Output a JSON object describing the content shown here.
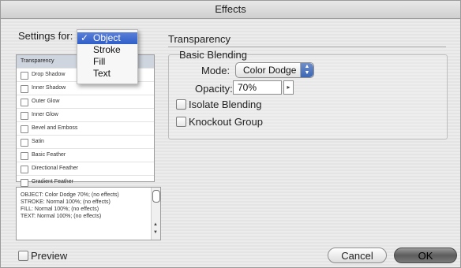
{
  "window": {
    "title": "Effects"
  },
  "settings": {
    "label": "Settings for:",
    "options": [
      {
        "label": "Object",
        "checked": true
      },
      {
        "label": "Stroke",
        "checked": false
      },
      {
        "label": "Fill",
        "checked": false
      },
      {
        "label": "Text",
        "checked": false
      }
    ],
    "selected": "Object",
    "check_glyph": "✓"
  },
  "effects_list": {
    "items": [
      {
        "label": "Transparency",
        "header": true
      },
      {
        "label": "Drop Shadow",
        "checked": false
      },
      {
        "label": "Inner Shadow",
        "checked": false
      },
      {
        "label": "Outer Glow",
        "checked": false
      },
      {
        "label": "Inner Glow",
        "checked": false
      },
      {
        "label": "Bevel and Emboss",
        "checked": false
      },
      {
        "label": "Satin",
        "checked": false
      },
      {
        "label": "Basic Feather",
        "checked": false
      },
      {
        "label": "Directional Feather",
        "checked": false
      },
      {
        "label": "Gradient Feather",
        "checked": false
      }
    ]
  },
  "summary": {
    "lines": [
      "OBJECT: Color Dodge 70%; (no effects)",
      "STROKE: Normal 100%; (no effects)",
      "FILL: Normal 100%; (no effects)",
      "TEXT: Normal 100%; (no effects)"
    ],
    "arrow_up": "▲",
    "arrow_down": "▼"
  },
  "panel": {
    "title": "Transparency",
    "group_title": "Basic Blending",
    "mode_label": "Mode:",
    "mode_value": "Color Dodge",
    "mode_stepper_up": "▲",
    "mode_stepper_down": "▼",
    "opacity_label": "Opacity:",
    "opacity_value": "70%",
    "opacity_stepper": "▸",
    "isolate_blending": {
      "label": "Isolate Blending",
      "checked": false
    },
    "knockout_group": {
      "label": "Knockout Group",
      "checked": false
    }
  },
  "footer": {
    "preview": {
      "label": "Preview",
      "checked": false
    },
    "cancel_label": "Cancel",
    "ok_label": "OK"
  },
  "colors": {
    "accent": "#3a63c6",
    "ok_button": "#6a6a6a"
  }
}
